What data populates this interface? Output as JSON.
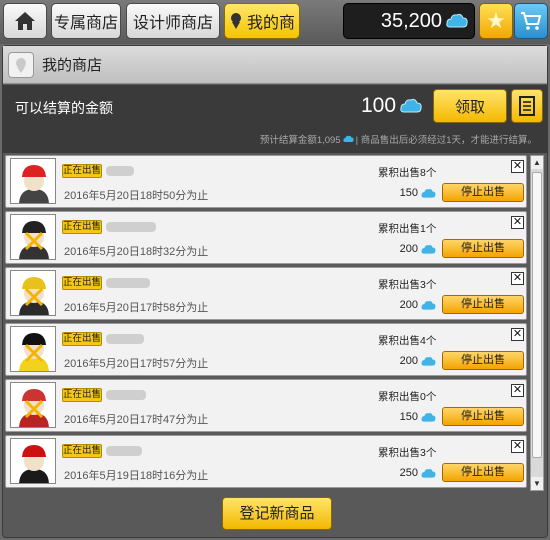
{
  "tabs": {
    "home_icon": "home-icon",
    "exclusive": "专属商店",
    "designer": "设计师商店",
    "my_shop": "我的商"
  },
  "wallet": {
    "balance": "35,200",
    "currency_icon": "cloud-gem-icon"
  },
  "panel": {
    "title": "我的商店",
    "settle_label": "可以结算的金额",
    "settle_amount": "100",
    "claim_label": "领取",
    "note_prefix": "预计结算金额1,095",
    "note_suffix": "| 商品售出后必须经过1天，才能进行结算。"
  },
  "items": [
    {
      "status": "正在出售",
      "date": "2016年5月20日18时50分为止",
      "sold": "累积出售8个",
      "price": "150",
      "stop": "停止出售",
      "avatar": "avatar-red-cap-suit"
    },
    {
      "status": "正在出售",
      "date": "2016年5月20日18时32分为止",
      "sold": "累积出售1个",
      "price": "200",
      "stop": "停止出售",
      "avatar": "avatar-black-hood"
    },
    {
      "status": "正在出售",
      "date": "2016年5月20日17时58分为止",
      "sold": "累积出售3个",
      "price": "200",
      "stop": "停止出售",
      "avatar": "avatar-yellow-hat"
    },
    {
      "status": "正在出售",
      "date": "2016年5月20日17时57分为止",
      "sold": "累积出售4个",
      "price": "200",
      "stop": "停止出售",
      "avatar": "avatar-yellow-jacket"
    },
    {
      "status": "正在出售",
      "date": "2016年5月20日17时47分为止",
      "sold": "累积出售0个",
      "price": "150",
      "stop": "停止出售",
      "avatar": "avatar-red-jacket"
    },
    {
      "status": "正在出售",
      "date": "2016年5月19日18时16分为止",
      "sold": "累积出售3个",
      "price": "250",
      "stop": "停止出售",
      "avatar": "avatar-red-beret"
    }
  ],
  "register_label": "登记新商品",
  "colors": {
    "accent_yellow": "#f5c400",
    "gem_blue": "#3fb4e8",
    "panel_dark": "#3a3a3a"
  }
}
